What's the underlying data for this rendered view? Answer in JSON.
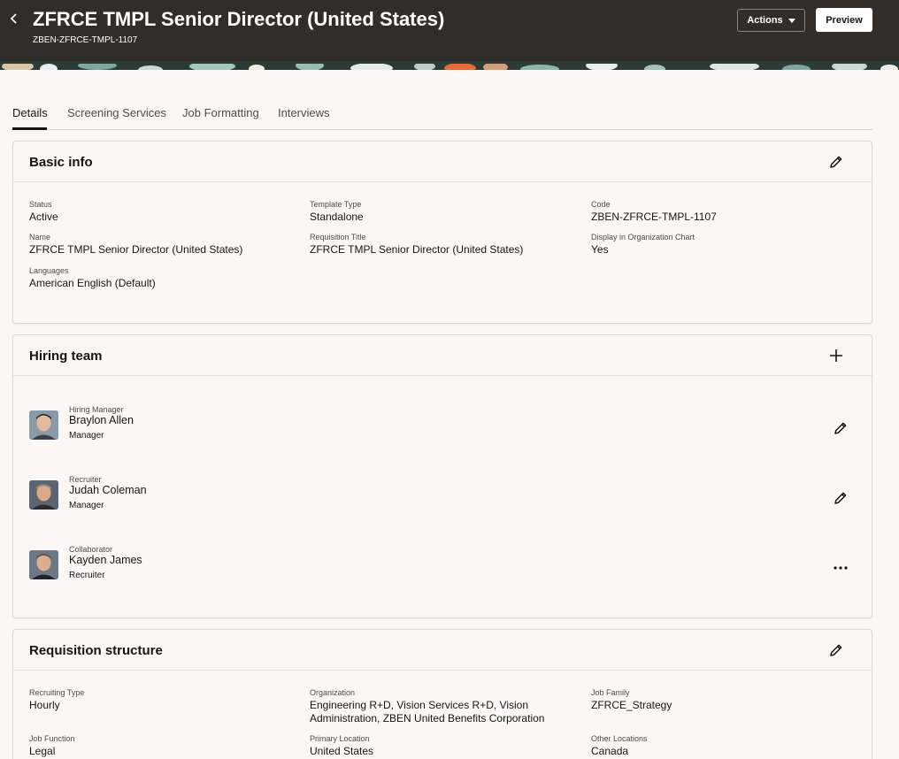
{
  "header": {
    "title": "ZFRCE TMPL Senior Director (United States)",
    "subtitle": "ZBEN-ZFRCE-TMPL-1107",
    "actions_label": "Actions",
    "preview_label": "Preview",
    "background": "#312d2a"
  },
  "tabs": [
    {
      "label": "Details",
      "active": true
    },
    {
      "label": "Screening Services",
      "active": false
    },
    {
      "label": "Job Formatting",
      "active": false
    },
    {
      "label": "Interviews",
      "active": false
    }
  ],
  "basic_info": {
    "title": "Basic info",
    "fields": {
      "status": {
        "label": "Status",
        "value": "Active"
      },
      "template_type": {
        "label": "Template Type",
        "value": "Standalone"
      },
      "code": {
        "label": "Code",
        "value": "ZBEN-ZFRCE-TMPL-1107"
      },
      "name": {
        "label": "Name",
        "value": "ZFRCE TMPL Senior Director (United States)"
      },
      "requisition_title": {
        "label": "Requisition Title",
        "value": "ZFRCE TMPL Senior Director (United States)"
      },
      "display_org_chart": {
        "label": "Display in Organization Chart",
        "value": "Yes"
      },
      "languages": {
        "label": "Languages",
        "value": "American English (Default)"
      }
    }
  },
  "hiring_team": {
    "title": "Hiring team",
    "members": [
      {
        "role": "Hiring Manager",
        "name": "Braylon Allen",
        "title": "Manager",
        "action_icon": "pencil-icon"
      },
      {
        "role": "Recruiter",
        "name": "Judah Coleman",
        "title": "Manager",
        "action_icon": "pencil-icon"
      },
      {
        "role": "Collaborator",
        "name": "Kayden James",
        "title": "Recruiter",
        "action_icon": "more-icon"
      }
    ]
  },
  "requisition_structure": {
    "title": "Requisition structure",
    "fields": {
      "recruiting_type": {
        "label": "Recruiting Type",
        "value": "Hourly"
      },
      "organization": {
        "label": "Organization",
        "value": "Engineering R+D, Vision Services R+D, Vision Administration, ZBEN United Benefits Corporation"
      },
      "job_family": {
        "label": "Job Family",
        "value": "ZFRCE_Strategy"
      },
      "job_function": {
        "label": "Job Function",
        "value": "Legal"
      },
      "primary_location": {
        "label": "Primary Location",
        "value": "United States"
      },
      "other_locations": {
        "label": "Other Locations",
        "value": "Canada"
      }
    }
  }
}
